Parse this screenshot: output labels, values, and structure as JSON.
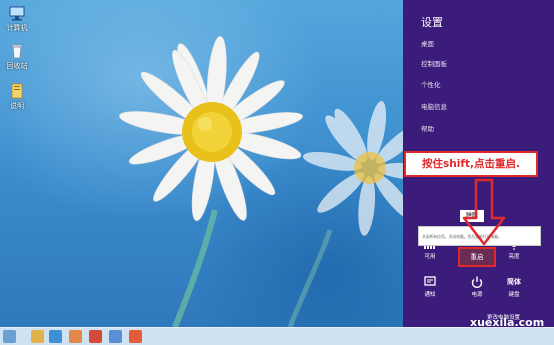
{
  "desktop": {
    "icons": [
      {
        "name": "computer-icon",
        "label": "计算机"
      },
      {
        "name": "recycle-bin-icon",
        "label": "回收站"
      },
      {
        "name": "folder-icon",
        "label": "说明"
      }
    ]
  },
  "charm": {
    "title": "设置",
    "links": [
      "桌面",
      "控制面板",
      "个性化",
      "电脑信息",
      "帮助"
    ],
    "tiles_row1": [
      {
        "name": "network-icon",
        "label": "可用"
      },
      {
        "name": "volume-icon",
        "label": ""
      },
      {
        "name": "brightness-icon",
        "label": "亮度"
      }
    ],
    "tiles_row2": [
      {
        "name": "notifications-icon",
        "label": "通知"
      },
      {
        "name": "power-icon",
        "label": "电源"
      },
      {
        "name": "keyboard-icon",
        "label": "键盘",
        "sub": "简体"
      }
    ],
    "change_settings": "更改电脑设置"
  },
  "power_menu": {
    "sleep": "睡眠",
    "description": "关闭所有应用，关闭电脑，然后重新打开电脑。",
    "restart": "重启"
  },
  "annotation": {
    "text": "按住shift,点击重启."
  },
  "watermark": "xuexila.com",
  "colors": {
    "charm_bg": "#3b1c7a",
    "annotation_red": "#e0292c",
    "taskbar": "#cfe2f1"
  }
}
